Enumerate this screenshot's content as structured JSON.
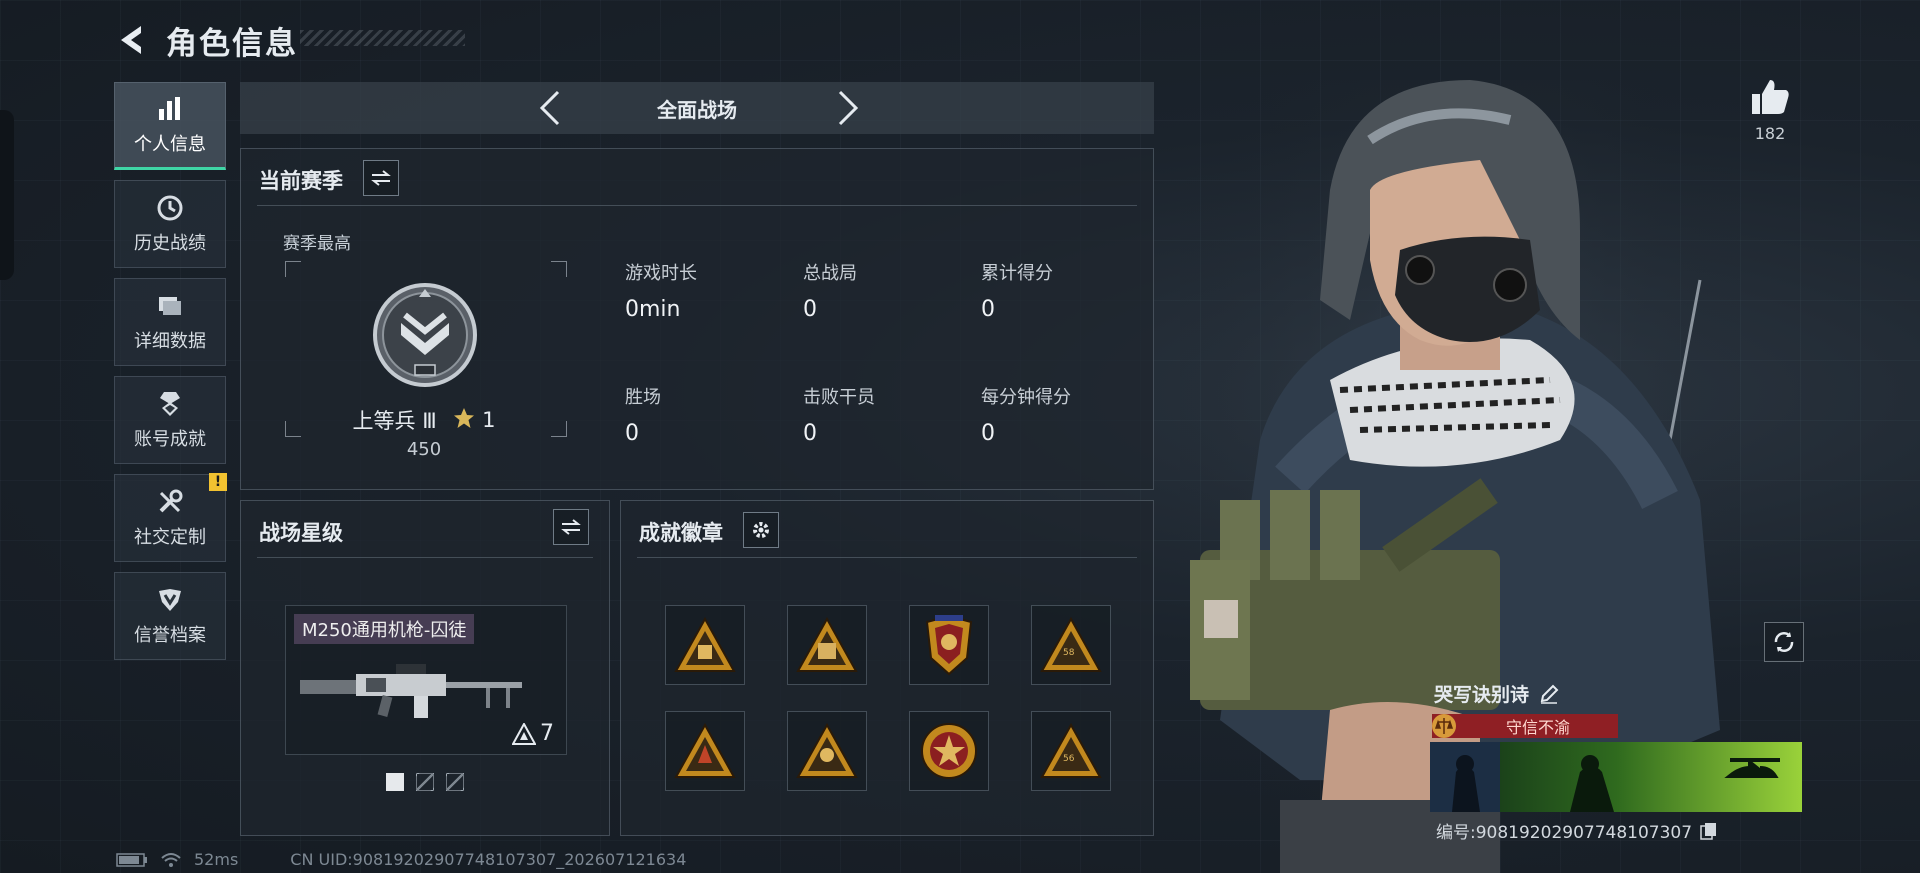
{
  "header": {
    "title": "角色信息"
  },
  "sidebar": {
    "items": [
      {
        "label": "个人信息",
        "icon": "bar-chart-icon",
        "active": true
      },
      {
        "label": "历史战绩",
        "icon": "history-clock-icon",
        "active": false
      },
      {
        "label": "详细数据",
        "icon": "folder-data-icon",
        "active": false
      },
      {
        "label": "账号成就",
        "icon": "achievement-medal-icon",
        "active": false
      },
      {
        "label": "社交定制",
        "icon": "wrench-tools-icon",
        "active": false,
        "badge": "!"
      },
      {
        "label": "信誉档案",
        "icon": "reputation-shield-icon",
        "active": false
      }
    ]
  },
  "mode": {
    "title": "全面战场"
  },
  "season": {
    "title": "当前赛季",
    "best_label": "赛季最高",
    "rank_name": "上等兵 Ⅲ",
    "rank_stars": "1",
    "rank_points": "450",
    "stats": [
      {
        "label": "游戏时长",
        "value": "0min"
      },
      {
        "label": "总战局",
        "value": "0"
      },
      {
        "label": "累计得分",
        "value": "0"
      },
      {
        "label": "胜场",
        "value": "0"
      },
      {
        "label": "击败干员",
        "value": "0"
      },
      {
        "label": "每分钟得分",
        "value": "0"
      }
    ]
  },
  "battlefield_star": {
    "title": "战场星级",
    "weapon_name": "M250通用机枪-囚徒",
    "weapon_level": "7",
    "pages": 3,
    "current_page": 1
  },
  "badges": {
    "title": "成就徽章",
    "items": [
      "triangle-badge-icon",
      "triangle-badge-icon",
      "shield-badge-icon",
      "triangle-badge-icon",
      "triangle-badge-icon",
      "triangle-badge-icon",
      "round-star-badge-icon",
      "triangle-badge-icon"
    ],
    "numbers": [
      "",
      "",
      "",
      "58",
      "",
      "",
      "",
      "56"
    ]
  },
  "footer": {
    "ping": "52ms",
    "uid": "CN UID:9081920290774810730​7_202607121634"
  },
  "profile": {
    "likes": "182",
    "player_name": "哭写诀别诗",
    "title_text": "守信不渝",
    "card_id": "编号:9081920290774810730​7"
  },
  "colors": {
    "accent": "#3fd6a6",
    "warning": "#f2c230",
    "title_banner": "#8f1f24",
    "badge_gold": "#d9a63b"
  }
}
